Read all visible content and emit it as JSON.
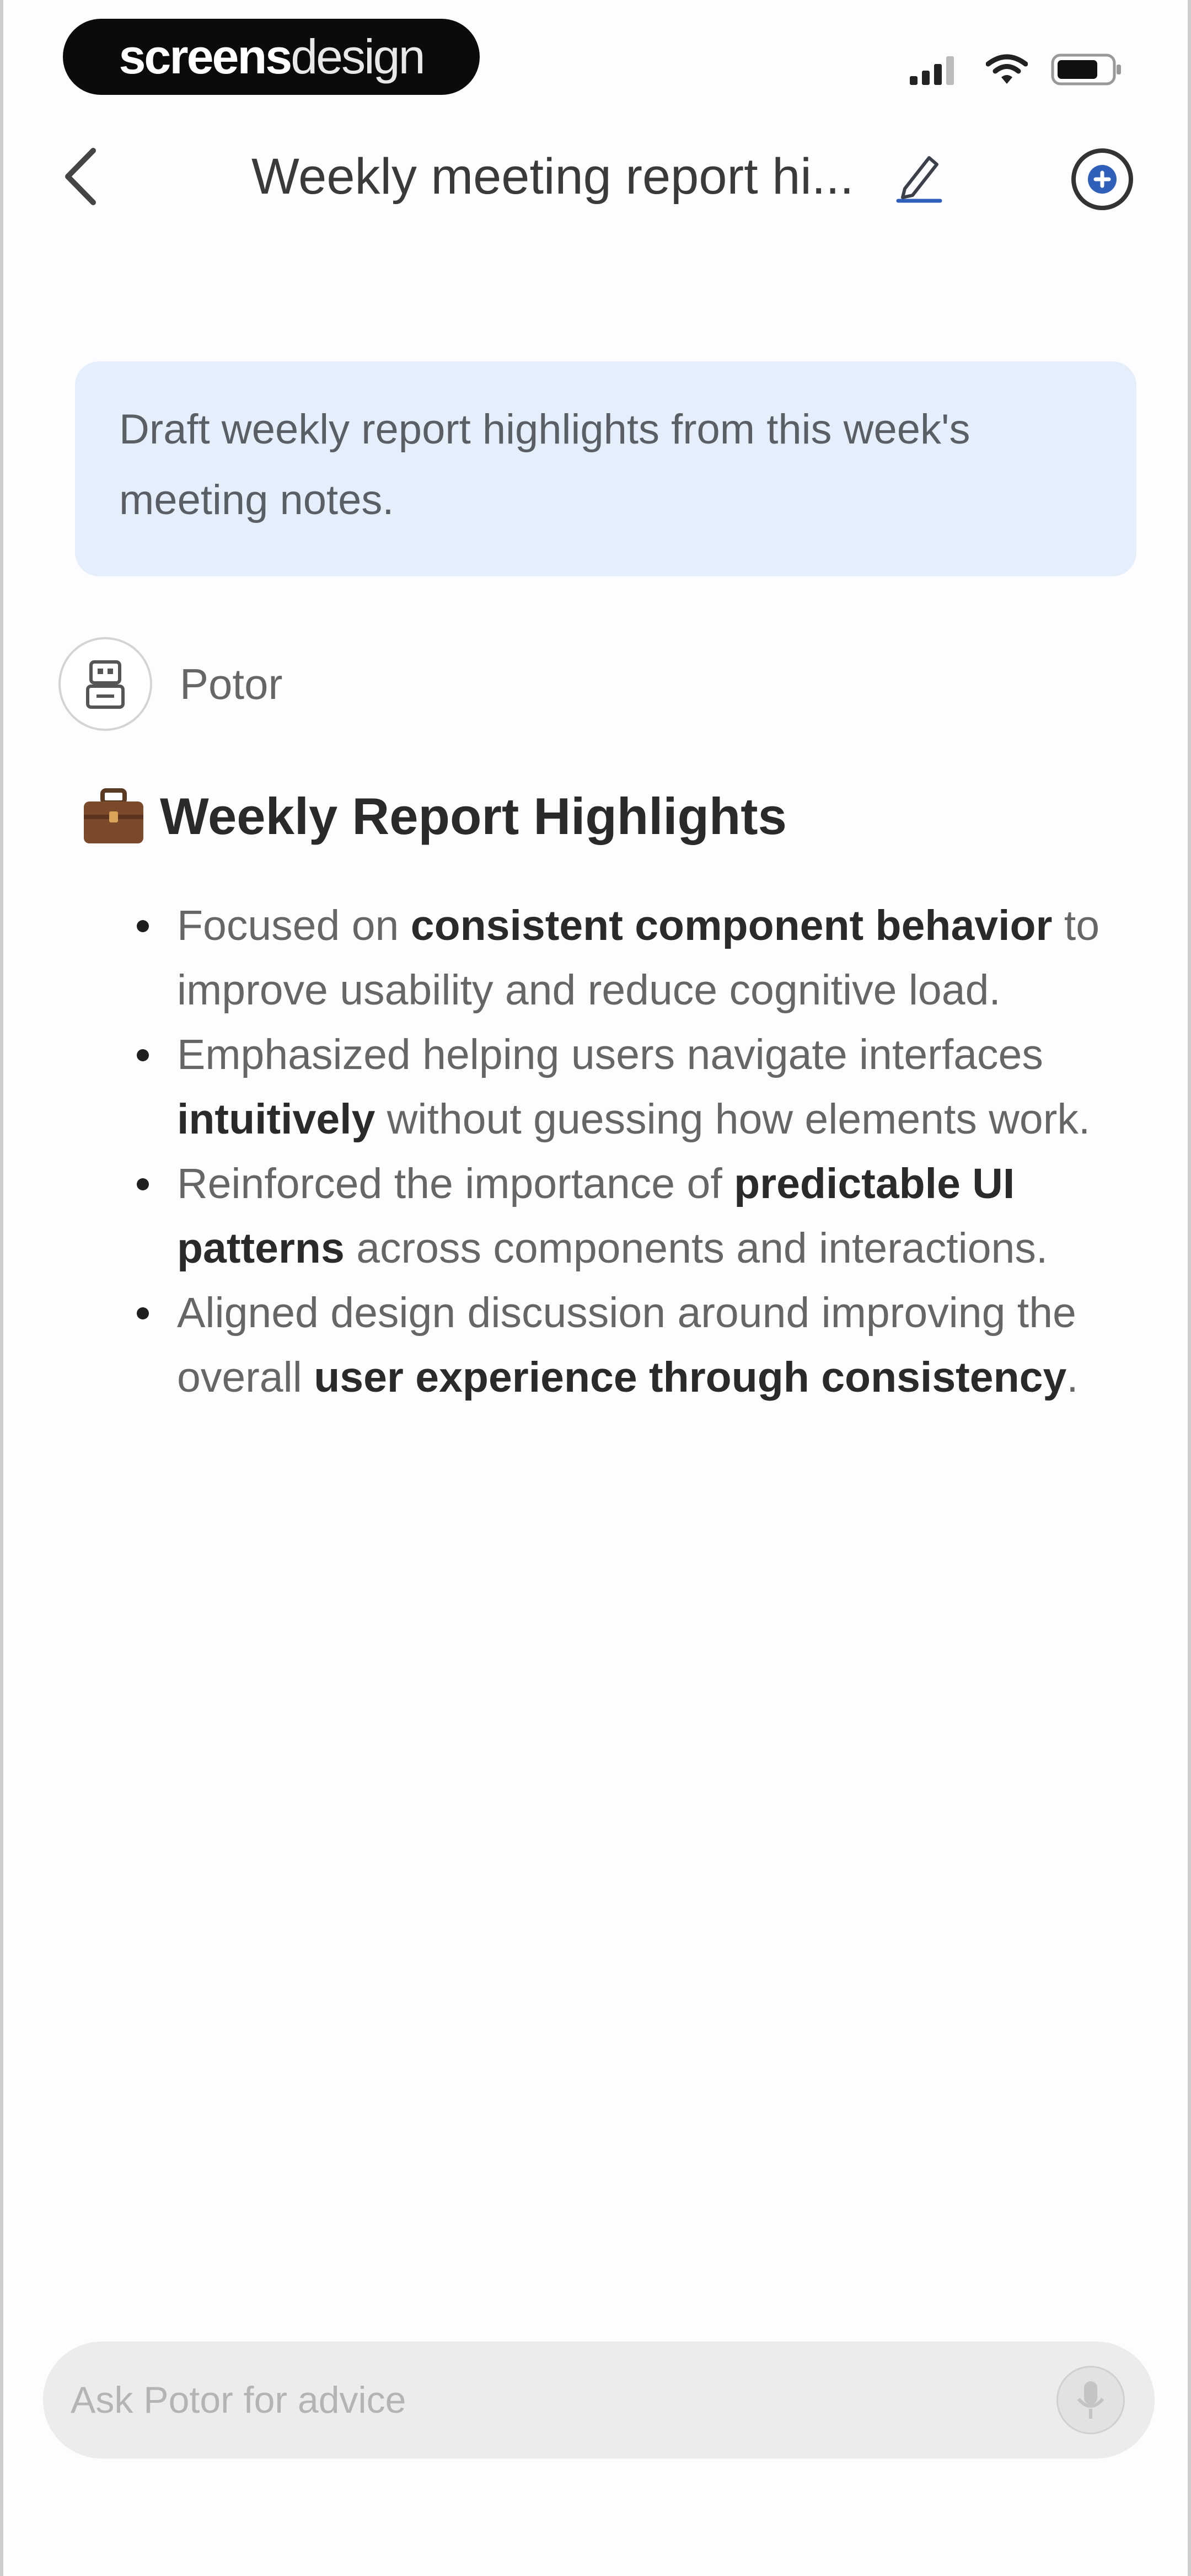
{
  "status_bar": {
    "brand_strong": "screens",
    "brand_light": "design"
  },
  "nav": {
    "title": "Weekly meeting report hi..."
  },
  "user_message": {
    "text": "Draft weekly report highlights from this week's meeting notes."
  },
  "assistant": {
    "name": "Potor"
  },
  "response": {
    "heading": "Weekly Report Highlights",
    "bullets": [
      [
        {
          "text": "Focused on ",
          "bold": false
        },
        {
          "text": "consistent component behavior",
          "bold": true
        },
        {
          "text": " to improve usability and reduce cognitive load.",
          "bold": false
        }
      ],
      [
        {
          "text": "Emphasized helping users navigate interfaces ",
          "bold": false
        },
        {
          "text": "intuitively",
          "bold": true
        },
        {
          "text": " without guessing how elements work.",
          "bold": false
        }
      ],
      [
        {
          "text": "Reinforced the importance of ",
          "bold": false
        },
        {
          "text": "predictable UI patterns",
          "bold": true
        },
        {
          "text": " across components and interactions.",
          "bold": false
        }
      ],
      [
        {
          "text": "Aligned design discussion around improving the overall ",
          "bold": false
        },
        {
          "text": "user experience through consistency",
          "bold": true
        },
        {
          "text": ".",
          "bold": false
        }
      ]
    ]
  },
  "composer": {
    "placeholder": "Ask Potor for advice",
    "value": ""
  },
  "icons": {
    "back": "chevron-left-icon",
    "edit": "pencil-icon",
    "new_chat": "plus-circle-icon",
    "assistant_avatar": "robot-icon",
    "heading_emoji": "briefcase-icon",
    "mic": "microphone-icon",
    "signal": "cellular-signal-icon",
    "wifi": "wifi-icon",
    "battery": "battery-icon"
  },
  "colors": {
    "user_bubble": "#e5effc",
    "accent": "#2f5fb8",
    "composer_bg": "#ececec"
  }
}
